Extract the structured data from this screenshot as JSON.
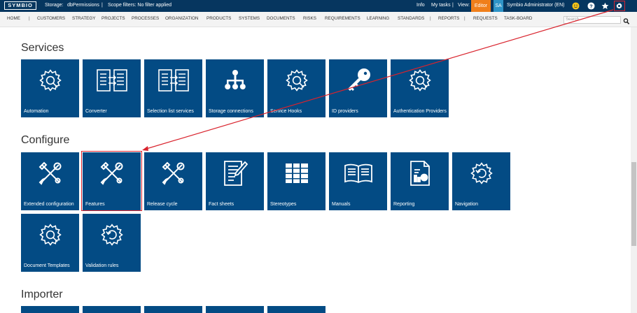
{
  "topbar": {
    "logo": "SYMBIO",
    "storage_label": "Storage:",
    "storage_value": "dbPermissions",
    "separator": "|",
    "scope_filters": "Scope filters: No filter applied",
    "info": "Info",
    "my_tasks": "My tasks",
    "view_label": "View:",
    "editor": "Editor",
    "avatar_initials": "SA",
    "user_name": "Symbio Administrator (EN)",
    "icons": [
      "smiley-icon",
      "help-icon",
      "star-icon",
      "gear-icon"
    ],
    "colors": {
      "bar": "#06365f",
      "editor": "#f07f1b",
      "avatar": "#2e94c7",
      "highlight": "#d9232d"
    }
  },
  "nav": {
    "items": [
      "HOME",
      "CUSTOMERS",
      "STRATEGY",
      "PROJECTS",
      "PROCESSES",
      "ORGANIZATION",
      "PRODUCTS",
      "SYSTEMS",
      "DOCUMENTS",
      "RISKS",
      "REQUIREMENTS",
      "LEARNING",
      "STANDARDS",
      "REPORTS",
      "REQUESTS",
      "TASK-BOARD"
    ],
    "search_placeholder": "Search"
  },
  "sections": {
    "services": {
      "title": "Services",
      "tiles": [
        {
          "label": "Automation",
          "icon": "gear-wrench-icon"
        },
        {
          "label": "Converter",
          "icon": "converter-icon"
        },
        {
          "label": "Selection list services",
          "icon": "converter-icon"
        },
        {
          "label": "Storage connections",
          "icon": "hierarchy-icon"
        },
        {
          "label": "Service Hooks",
          "icon": "gear-wrench-icon"
        },
        {
          "label": "ID providers",
          "icon": "key-icon"
        },
        {
          "label": "Authentication Providers",
          "icon": "gear-wrench-icon"
        }
      ]
    },
    "configure": {
      "title": "Configure",
      "tiles": [
        {
          "label": "Extended configuration",
          "icon": "tools-icon"
        },
        {
          "label": "Features",
          "icon": "tools-icon"
        },
        {
          "label": "Release cycle",
          "icon": "tools-icon"
        },
        {
          "label": "Fact sheets",
          "icon": "fact-sheet-icon"
        },
        {
          "label": "Stereotypes",
          "icon": "grid-icon"
        },
        {
          "label": "Manuals",
          "icon": "book-icon"
        },
        {
          "label": "Reporting",
          "icon": "report-icon"
        },
        {
          "label": "Navigation",
          "icon": "gear-cycle-icon"
        },
        {
          "label": "Document Templates",
          "icon": "gear-wrench-icon"
        },
        {
          "label": "Validation rules",
          "icon": "gear-cycle-icon"
        }
      ]
    },
    "importer": {
      "title": "Importer"
    }
  },
  "tile_color": "#034b84"
}
